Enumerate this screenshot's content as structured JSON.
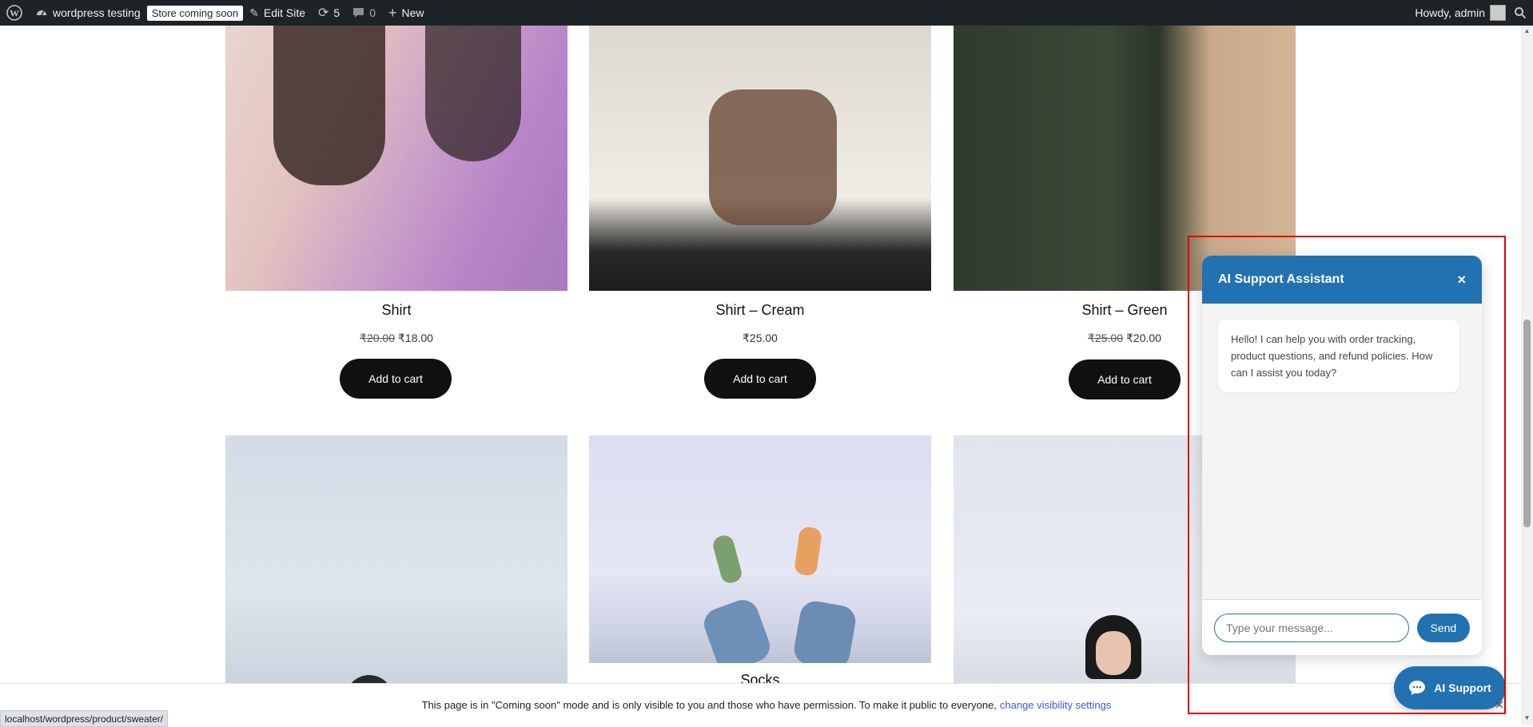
{
  "adminbar": {
    "site_name": "wordpress testing",
    "store_badge": "Store coming soon",
    "edit_site": "Edit Site",
    "updates_count": "5",
    "comments_count": "0",
    "new_label": "New",
    "howdy": "Howdy, admin"
  },
  "products": [
    {
      "title": "Shirt",
      "old_price": "₹20.00",
      "price": "₹18.00",
      "button": "Add to cart"
    },
    {
      "title": "Shirt – Cream",
      "old_price": "",
      "price": "₹25.00",
      "button": "Add to cart"
    },
    {
      "title": "Shirt – Green",
      "old_price": "₹25.00",
      "price": "₹20.00",
      "button": "Add to cart"
    },
    {
      "title": "Socks"
    }
  ],
  "coming_soon": {
    "text": "This page is in \"Coming soon\" mode and is only visible to you and those who have permission. To make it public to everyone,",
    "link": "change visibility settings"
  },
  "status_url": "localhost/wordpress/product/sweater/",
  "chat": {
    "title": "AI Support Assistant",
    "close": "×",
    "greeting": "Hello! I can help you with order tracking, product questions, and refund policies. How can I assist you today?",
    "input_placeholder": "Type your message...",
    "send": "Send",
    "launcher": "AI Support"
  },
  "colors": {
    "adminbar_bg": "#1d2327",
    "chat_accent": "#2271b1",
    "button_dark": "#111111",
    "highlight": "#e10000"
  }
}
